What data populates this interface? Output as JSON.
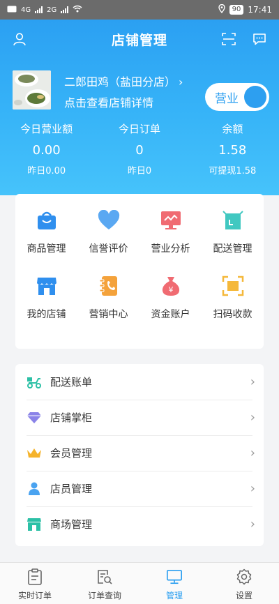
{
  "status_bar": {
    "time": "17:41",
    "battery": "90",
    "network": "4G",
    "network2": "2G"
  },
  "header": {
    "title": "店铺管理",
    "shop_name": "二郎田鸡（盐田分店）",
    "shop_link": "点击查看店铺详情",
    "open_status": "营业"
  },
  "stats": [
    {
      "label": "今日营业额",
      "value": "0.00",
      "sub": "昨日0.00"
    },
    {
      "label": "今日订单",
      "value": "0",
      "sub": "昨日0"
    },
    {
      "label": "余额",
      "value": "1.58",
      "sub": "可提现1.58"
    }
  ],
  "grid": [
    {
      "label": "商品管理",
      "icon": "shopping-basket-icon",
      "color": "#2f8fee"
    },
    {
      "label": "信誉评价",
      "icon": "heart-icon",
      "color": "#5aa8f2"
    },
    {
      "label": "营业分析",
      "icon": "monitor-chart-icon",
      "color": "#f06b72"
    },
    {
      "label": "配送管理",
      "icon": "delivery-box-icon",
      "color": "#41c8c1"
    },
    {
      "label": "我的店铺",
      "icon": "storefront-icon",
      "color": "#2f8fee"
    },
    {
      "label": "营销中心",
      "icon": "notebook-icon",
      "color": "#f4a23b"
    },
    {
      "label": "资金账户",
      "icon": "money-bag-icon",
      "color": "#f06b72"
    },
    {
      "label": "扫码收款",
      "icon": "scan-icon",
      "color": "#f5b83a"
    }
  ],
  "list": [
    {
      "label": "配送账单",
      "icon": "scooter-icon",
      "color": "#2cc0a6"
    },
    {
      "label": "店铺掌柜",
      "icon": "diamond-icon",
      "color": "#8a83e8"
    },
    {
      "label": "会员管理",
      "icon": "crown-icon",
      "color": "#f5b32b"
    },
    {
      "label": "店员管理",
      "icon": "person-icon",
      "color": "#4aa3f0"
    },
    {
      "label": "商场管理",
      "icon": "mall-icon",
      "color": "#2cc0a6"
    }
  ],
  "tabs": [
    {
      "label": "实时订单",
      "icon": "clipboard-icon",
      "active": false
    },
    {
      "label": "订单查询",
      "icon": "search-document-icon",
      "active": false
    },
    {
      "label": "管理",
      "icon": "monitor-icon",
      "active": true
    },
    {
      "label": "设置",
      "icon": "gear-icon",
      "active": false
    }
  ],
  "colors": {
    "primary": "#2b9ff0",
    "header_bottom": "#46c3fb"
  }
}
